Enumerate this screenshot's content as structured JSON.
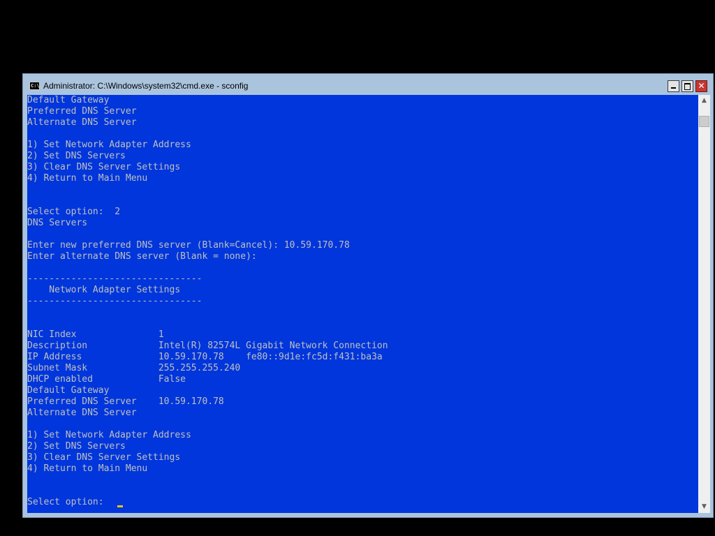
{
  "window": {
    "title": "Administrator: C:\\Windows\\system32\\cmd.exe - sconfig",
    "icon_label": "C:\\",
    "icon_name": "cmd-icon",
    "controls": {
      "minimize": "minimize-icon",
      "maximize": "maximize-icon",
      "close": "close-icon",
      "close_glyph": "✕"
    }
  },
  "console": {
    "background": "#0036db",
    "foreground": "#c0c0c0",
    "cursor_color": "#e6c21a",
    "lines": [
      "Default Gateway",
      "Preferred DNS Server",
      "Alternate DNS Server",
      "",
      "1) Set Network Adapter Address",
      "2) Set DNS Servers",
      "3) Clear DNS Server Settings",
      "4) Return to Main Menu",
      "",
      "",
      "Select option:  2",
      "DNS Servers",
      "",
      "Enter new preferred DNS server (Blank=Cancel): 10.59.170.78",
      "Enter alternate DNS server (Blank = none):",
      "",
      "--------------------------------",
      "    Network Adapter Settings",
      "--------------------------------",
      "",
      "",
      "NIC Index               1",
      "Description             Intel(R) 82574L Gigabit Network Connection",
      "IP Address              10.59.170.78    fe80::9d1e:fc5d:f431:ba3a",
      "Subnet Mask             255.255.255.240",
      "DHCP enabled            False",
      "Default Gateway",
      "Preferred DNS Server    10.59.170.78",
      "Alternate DNS Server",
      "",
      "1) Set Network Adapter Address",
      "2) Set DNS Servers",
      "3) Clear DNS Server Settings",
      "4) Return to Main Menu",
      "",
      "",
      "Select option:  "
    ]
  },
  "scrollbar": {
    "up_glyph": "▲",
    "down_glyph": "▼"
  }
}
